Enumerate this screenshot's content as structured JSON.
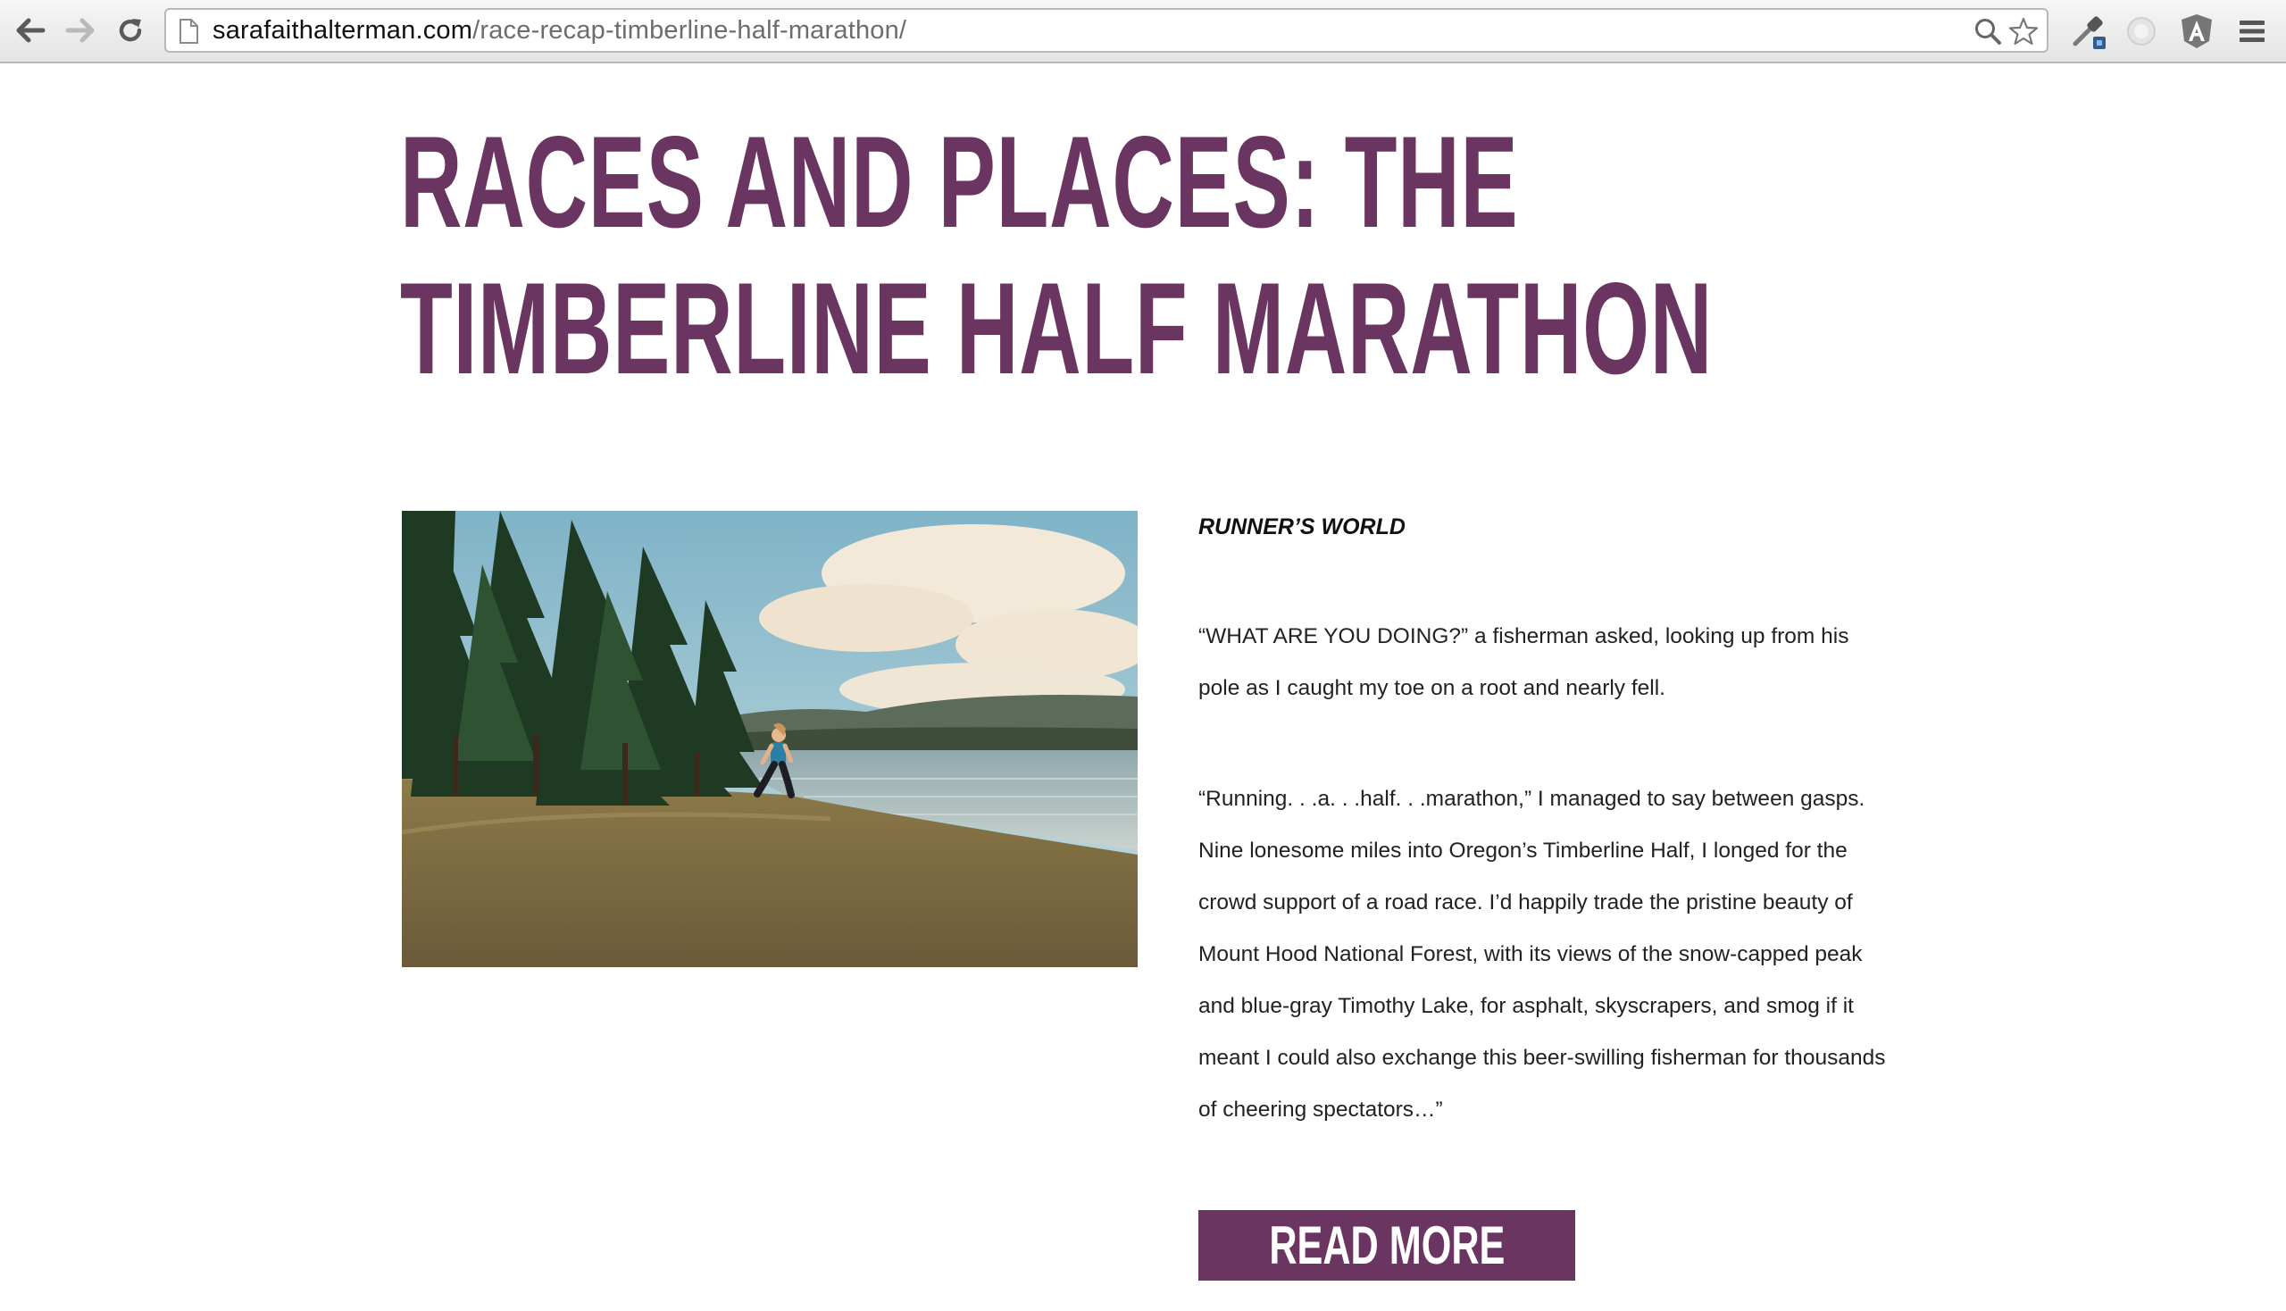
{
  "browser": {
    "url_host": "sarafaithalterman.com",
    "url_path": "/race-recap-timberline-half-marathon/",
    "nav": {
      "back_icon": "back-arrow-icon",
      "forward_icon": "forward-arrow-icon",
      "reload_icon": "reload-icon"
    },
    "omnibox_icons": [
      "page-icon",
      "search-icon",
      "bookmark-star-icon"
    ],
    "extensions": [
      "eyedropper-extension-icon",
      "extension-circle-icon",
      "angular-extension-icon",
      "menu-icon"
    ]
  },
  "article": {
    "title_line1": "Races and Places: The",
    "title_line2": "Timberline Half Marathon",
    "publication": "RUNNER’S WORLD",
    "paragraphs": [
      "“WHAT ARE YOU DOING?” a fisherman asked, looking up from his pole as I caught my toe on a root and nearly fell.",
      "“Running. . .a. . .half. . .marathon,” I managed to say between gasps. Nine lonesome miles into Oregon’s Timberline Half, I longed for the crowd support of a road race. I’d happily trade the pristine beauty of Mount Hood National Forest, with its views of the snow-capped peak and blue-gray Timothy Lake, for asphalt, skyscrapers, and smog if it meant I could also exchange this beer-swilling fisherman for thousands of cheering spectators…”"
    ],
    "read_more_label": "Read More"
  },
  "colors": {
    "brand_purple": "#6b3561",
    "text": "#222222",
    "chrome_bg": "#e9e9e9"
  }
}
